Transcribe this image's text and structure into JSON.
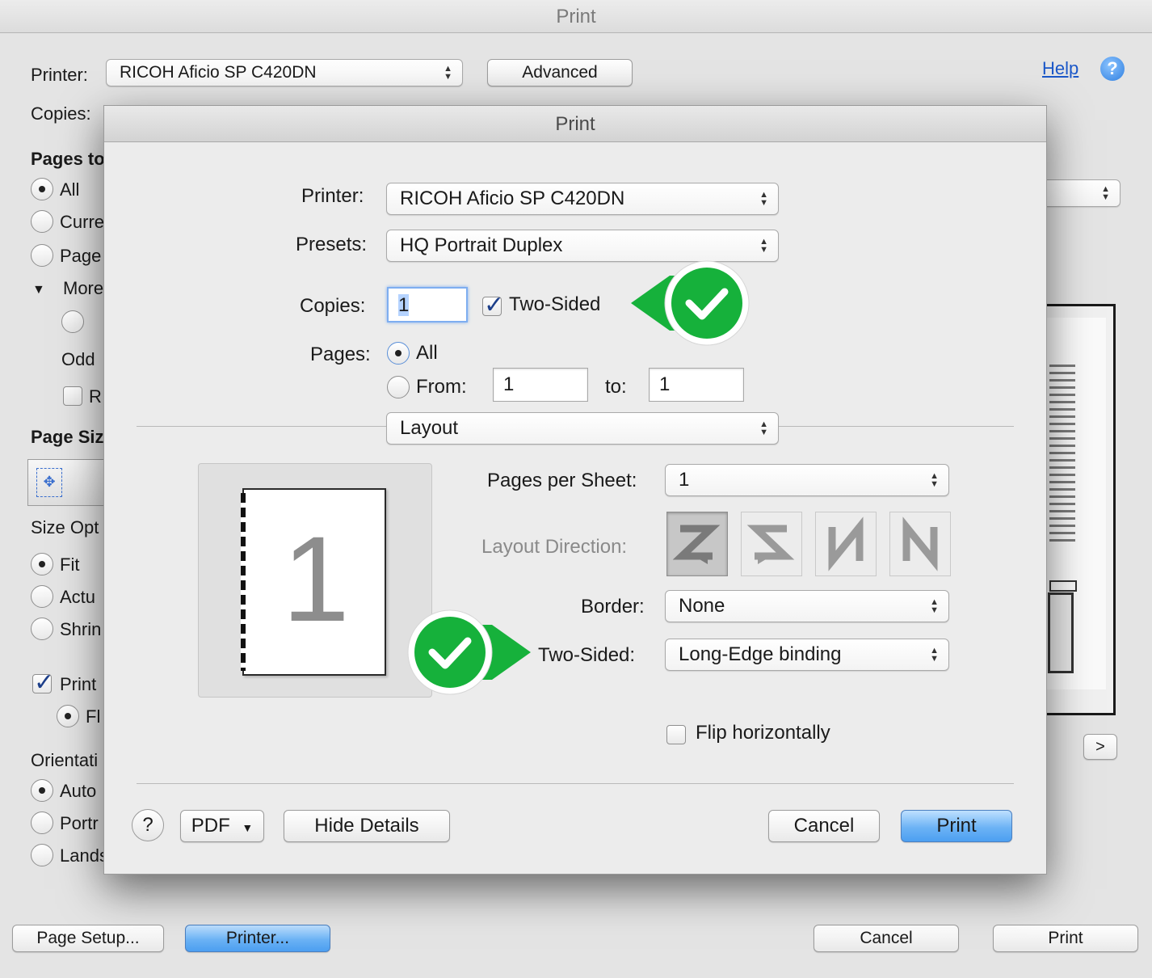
{
  "background_window": {
    "title": "Print",
    "printer_label": "Printer:",
    "printer_value": "RICOH Aficio SP C420DN",
    "advanced_button": "Advanced",
    "help_link": "Help",
    "copies_label": "Copies:",
    "pages_heading": "Pages to",
    "radio_all": "All",
    "radio_current": "Curre",
    "radio_pages": "Page",
    "more_label": "More",
    "odd_label": "Odd",
    "r_label": "R",
    "page_size_heading": "Page Siz",
    "size_options_heading": "Size Opt",
    "fit_label": "Fit",
    "actual_label": "Actu",
    "shrink_label": "Shrin",
    "print_label": "Print",
    "fl_label": "Fl",
    "orientation_heading": "Orientati",
    "auto_label": "Auto",
    "portrait_label": "Portr",
    "landscape_label": "Lands",
    "next_button": ">",
    "page_setup_button": "Page Setup...",
    "printer_button": "Printer...",
    "cancel_button": "Cancel",
    "print_button": "Print"
  },
  "dialog": {
    "title": "Print",
    "printer_label": "Printer:",
    "printer_value": "RICOH Aficio SP C420DN",
    "presets_label": "Presets:",
    "presets_value": "HQ Portrait Duplex",
    "copies_label": "Copies:",
    "copies_value": "1",
    "two_sided_checkbox": "Two-Sided",
    "two_sided_checked": true,
    "pages_label": "Pages:",
    "pages_all": "All",
    "pages_from": "From:",
    "from_value": "1",
    "to_label": "to:",
    "to_value": "1",
    "section_value": "Layout",
    "preview_page_number": "1",
    "pages_per_sheet_label": "Pages per Sheet:",
    "pages_per_sheet_value": "1",
    "layout_direction_label": "Layout Direction:",
    "border_label": "Border:",
    "border_value": "None",
    "two_sided_label": "Two-Sided:",
    "two_sided_value": "Long-Edge binding",
    "flip_label": "Flip horizontally",
    "help_button": "?",
    "pdf_button": "PDF",
    "hide_details_button": "Hide Details",
    "cancel_button": "Cancel",
    "print_button": "Print"
  },
  "colors": {
    "callout_green": "#16b13b",
    "accent_blue": "#5ca8f3",
    "link_blue": "#1a57c8"
  }
}
